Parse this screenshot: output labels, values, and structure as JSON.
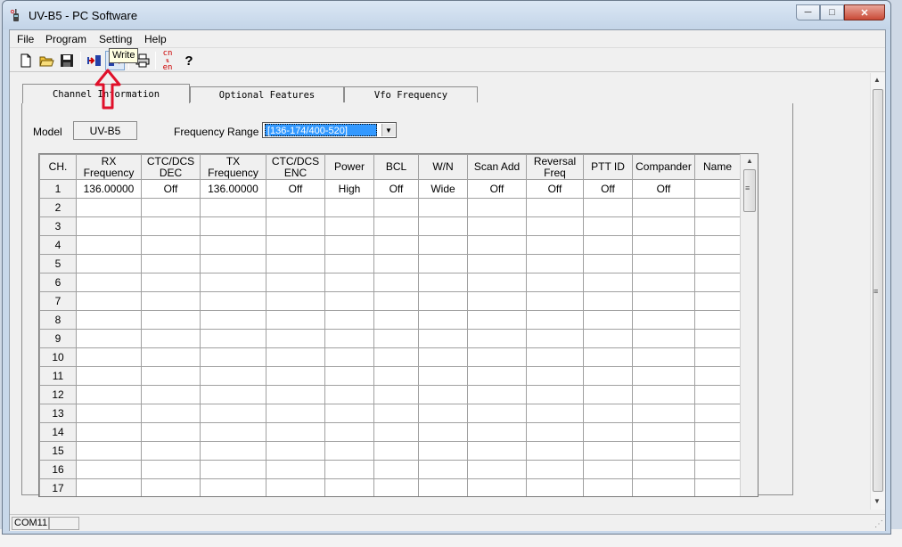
{
  "window": {
    "title": "UV-B5 - PC Software"
  },
  "menu": [
    "File",
    "Program",
    "Setting",
    "Help"
  ],
  "toolbar": {
    "tooltip": "Write",
    "language_icon_top": "cn",
    "language_icon_bottom": "en"
  },
  "tabs": [
    "Channel Information",
    "Optional Features",
    "Vfo Frequency"
  ],
  "form": {
    "model_label": "Model",
    "model_value": "UV-B5",
    "freq_range_label": "Frequency Range",
    "freq_range_value": "[136-174/400-520]"
  },
  "table": {
    "headers": [
      "CH.",
      "RX Frequency",
      "CTC/DCS DEC",
      "TX Frequency",
      "CTC/DCS ENC",
      "Power",
      "BCL",
      "W/N",
      "Scan Add",
      "Reversal Freq",
      "PTT ID",
      "Compander",
      "Name"
    ],
    "rows": [
      [
        "1",
        "136.00000",
        "Off",
        "136.00000",
        "Off",
        "High",
        "Off",
        "Wide",
        "Off",
        "Off",
        "Off",
        "Off",
        ""
      ],
      [
        "2",
        "",
        "",
        "",
        "",
        "",
        "",
        "",
        "",
        "",
        "",
        "",
        ""
      ],
      [
        "3",
        "",
        "",
        "",
        "",
        "",
        "",
        "",
        "",
        "",
        "",
        "",
        ""
      ],
      [
        "4",
        "",
        "",
        "",
        "",
        "",
        "",
        "",
        "",
        "",
        "",
        "",
        ""
      ],
      [
        "5",
        "",
        "",
        "",
        "",
        "",
        "",
        "",
        "",
        "",
        "",
        "",
        ""
      ],
      [
        "6",
        "",
        "",
        "",
        "",
        "",
        "",
        "",
        "",
        "",
        "",
        "",
        ""
      ],
      [
        "7",
        "",
        "",
        "",
        "",
        "",
        "",
        "",
        "",
        "",
        "",
        "",
        ""
      ],
      [
        "8",
        "",
        "",
        "",
        "",
        "",
        "",
        "",
        "",
        "",
        "",
        "",
        ""
      ],
      [
        "9",
        "",
        "",
        "",
        "",
        "",
        "",
        "",
        "",
        "",
        "",
        "",
        ""
      ],
      [
        "10",
        "",
        "",
        "",
        "",
        "",
        "",
        "",
        "",
        "",
        "",
        "",
        ""
      ],
      [
        "11",
        "",
        "",
        "",
        "",
        "",
        "",
        "",
        "",
        "",
        "",
        "",
        ""
      ],
      [
        "12",
        "",
        "",
        "",
        "",
        "",
        "",
        "",
        "",
        "",
        "",
        "",
        ""
      ],
      [
        "13",
        "",
        "",
        "",
        "",
        "",
        "",
        "",
        "",
        "",
        "",
        "",
        ""
      ],
      [
        "14",
        "",
        "",
        "",
        "",
        "",
        "",
        "",
        "",
        "",
        "",
        "",
        ""
      ],
      [
        "15",
        "",
        "",
        "",
        "",
        "",
        "",
        "",
        "",
        "",
        "",
        "",
        ""
      ],
      [
        "16",
        "",
        "",
        "",
        "",
        "",
        "",
        "",
        "",
        "",
        "",
        "",
        ""
      ],
      [
        "17",
        "",
        "",
        "",
        "",
        "",
        "",
        "",
        "",
        "",
        "",
        "",
        ""
      ]
    ]
  },
  "status": {
    "port": "COM11",
    "extra": ""
  },
  "colors": {
    "selection": "#3399ff",
    "arrow": "#e0102a",
    "close_button": "#c94a36"
  }
}
